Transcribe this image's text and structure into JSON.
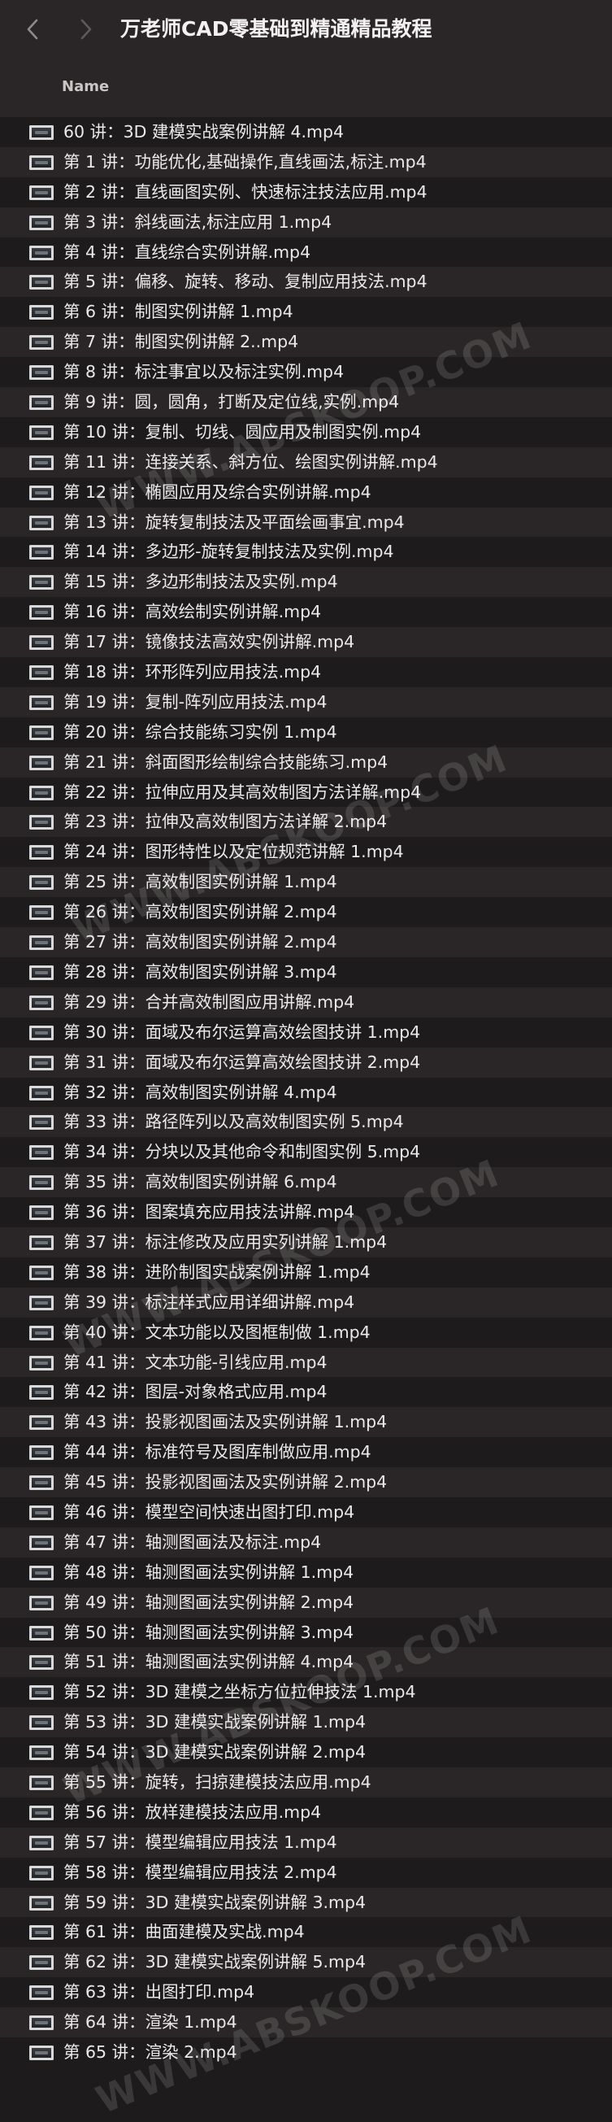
{
  "window": {
    "title": "万老师CAD零基础到精通精品教程"
  },
  "toolbar": {
    "back_icon": "chevron-left-icon",
    "forward_icon": "chevron-right-icon"
  },
  "list_header": {
    "name_label": "Name"
  },
  "files": [
    "60 讲：3D 建模实战案例讲解 4.mp4",
    "第 1 讲：功能优化,基础操作,直线画法,标注.mp4",
    "第 2 讲：直线画图实例、快速标注技法应用.mp4",
    "第 3 讲：斜线画法,标注应用 1.mp4",
    "第 4 讲：直线综合实例讲解.mp4",
    "第 5 讲：偏移、旋转、移动、复制应用技法.mp4",
    "第 6 讲：制图实例讲解 1.mp4",
    "第 7 讲：制图实例讲解 2..mp4",
    "第 8 讲：标注事宜以及标注实例.mp4",
    "第 9 讲：圆，圆角，打断及定位线,实例.mp4",
    "第 10 讲：复制、切线、圆应用及制图实例.mp4",
    "第 11 讲：连接关系、斜方位、绘图实例讲解.mp4",
    "第 12 讲：椭圆应用及综合实例讲解.mp4",
    "第 13 讲：旋转复制技法及平面绘画事宜.mp4",
    "第 14 讲：多边形-旋转复制技法及实例.mp4",
    "第 15 讲：多边形制技法及实例.mp4",
    "第 16 讲：高效绘制实例讲解.mp4",
    "第 17 讲：镜像技法高效实例讲解.mp4",
    "第 18 讲：环形阵列应用技法.mp4",
    "第 19 讲：复制-阵列应用技法.mp4",
    "第 20 讲：综合技能练习实例 1.mp4",
    "第 21 讲：斜面图形绘制综合技能练习.mp4",
    "第 22 讲：拉伸应用及其高效制图方法详解.mp4",
    "第 23 讲：拉伸及高效制图方法详解 2.mp4",
    "第 24 讲：图形特性以及定位规范讲解 1.mp4",
    "第 25 讲：高效制图实例讲解 1.mp4",
    "第 26 讲：高效制图实例讲解 2.mp4",
    "第 27 讲：高效制图实例讲解 2.mp4",
    "第 28 讲：高效制图实例讲解 3.mp4",
    "第 29 讲：合并高效制图应用讲解.mp4",
    "第 30 讲：面域及布尔运算高效绘图技讲 1.mp4",
    "第 31 讲：面域及布尔运算高效绘图技讲 2.mp4",
    "第 32 讲：高效制图实例讲解 4.mp4",
    "第 33 讲：路径阵列以及高效制图实例 5.mp4",
    "第 34 讲：分块以及其他命令和制图实例 5.mp4",
    "第 35 讲：高效制图实例讲解 6.mp4",
    "第 36 讲：图案填充应用技法讲解.mp4",
    "第 37 讲：标注修改及应用实列讲解 1.mp4",
    "第 38 讲：进阶制图实战案例讲解 1.mp4",
    "第 39 讲：标注样式应用详细讲解.mp4",
    "第 40 讲：文本功能以及图框制做 1.mp4",
    "第 41 讲：文本功能-引线应用.mp4",
    "第 42 讲：图层-对象格式应用.mp4",
    "第 43 讲：投影视图画法及实例讲解 1.mp4",
    "第 44 讲：标准符号及图库制做应用.mp4",
    "第 45 讲：投影视图画法及实例讲解 2.mp4",
    "第 46 讲：模型空间快速出图打印.mp4",
    "第 47 讲：轴测图画法及标注.mp4",
    "第 48 讲：轴测图画法实例讲解 1.mp4",
    "第 49 讲：轴测图画法实例讲解 2.mp4",
    "第 50 讲：轴测图画法实例讲解 3.mp4",
    "第 51 讲：轴测图画法实例讲解 4.mp4",
    "第 52 讲：3D 建模之坐标方位拉伸技法 1.mp4",
    "第 53 讲：3D 建模实战案例讲解 1.mp4",
    "第 54 讲：3D 建模实战案例讲解 2.mp4",
    "第 55 讲：旋转，扫掠建模技法应用.mp4",
    "第 56 讲：放样建模技法应用.mp4",
    "第 57 讲：模型编辑应用技法 1.mp4",
    "第 58 讲：模型编辑应用技法 2.mp4",
    "第 59 讲：3D 建模实战案例讲解 3.mp4",
    "第 61 讲：曲面建模及实战.mp4",
    "第 62 讲：3D 建模实战案例讲解 5.mp4",
    "第 63 讲：出图打印.mp4",
    "第 64 讲：渲染 1.mp4",
    "第 65 讲：渲染 2.mp4"
  ],
  "watermarks": [
    "WWW.ABSKOOP.COM",
    "WWW.ABSKOOP.COM",
    "WWW.ABSKOOP.COM",
    "WWW.ABSKOOP.COM",
    "WWW.ABSKOOP.COM"
  ]
}
